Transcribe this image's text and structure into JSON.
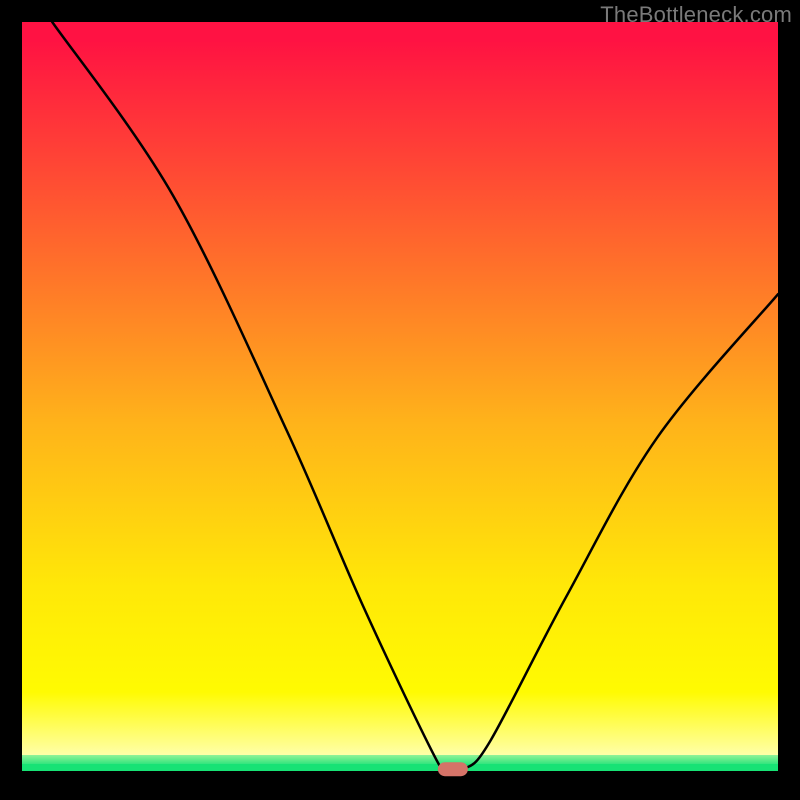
{
  "watermark": "TheBottleneck.com",
  "chart_data": {
    "type": "line",
    "title": "",
    "xlabel": "",
    "ylabel": "",
    "xlim": [
      0,
      100
    ],
    "ylim": [
      0,
      100
    ],
    "series": [
      {
        "name": "curve",
        "points": [
          {
            "x": 4,
            "y": 100
          },
          {
            "x": 20,
            "y": 77
          },
          {
            "x": 35,
            "y": 46
          },
          {
            "x": 45,
            "y": 23
          },
          {
            "x": 54,
            "y": 4
          },
          {
            "x": 56,
            "y": 1.2
          },
          {
            "x": 58.5,
            "y": 1.2
          },
          {
            "x": 62,
            "y": 5
          },
          {
            "x": 72,
            "y": 24
          },
          {
            "x": 84,
            "y": 45
          },
          {
            "x": 100,
            "y": 64
          }
        ]
      }
    ],
    "marker": {
      "x": 57,
      "y": 1.2,
      "width_pct": 4,
      "height_pct": 1.8
    },
    "bands": [
      {
        "from": 100,
        "to": 97.3,
        "color": "#ff1243"
      },
      {
        "from": 97.3,
        "to": 77.7,
        "top_color": "#ff1342",
        "bottom_color": "#ff5132"
      },
      {
        "from": 77.7,
        "to": 47.0,
        "top_color": "#ff5132",
        "bottom_color": "#ffb31a"
      },
      {
        "from": 47.0,
        "to": 25.3,
        "top_color": "#ffb31a",
        "bottom_color": "#ffe808"
      },
      {
        "from": 25.3,
        "to": 11.4,
        "top_color": "#ffe808",
        "bottom_color": "#fffb02"
      },
      {
        "from": 11.4,
        "to": 3.0,
        "top_color": "#fffb02",
        "bottom_color": "#ffffa8"
      },
      {
        "from": 3.0,
        "to": 1.9,
        "top_color": "#91f397",
        "bottom_color": "#33e57e"
      },
      {
        "from": 1.9,
        "to": 0.9,
        "color": "#17e275"
      },
      {
        "from": 0.9,
        "to": 0.0,
        "color": "#000000"
      }
    ]
  }
}
